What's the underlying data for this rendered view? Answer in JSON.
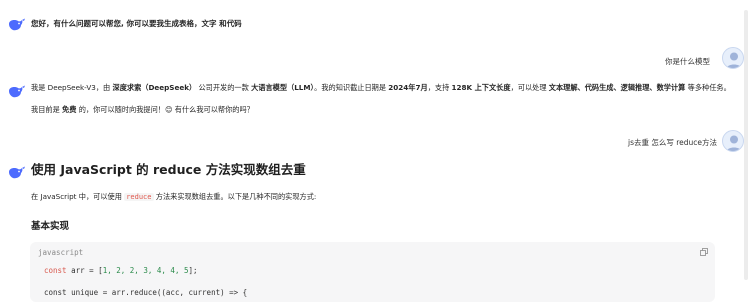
{
  "greeting": {
    "text": "您好，有什么问题可以帮您, 你可以要我生成表格，文字 和代码"
  },
  "messages": {
    "user1": "你是什么模型",
    "bot1": {
      "p1_a": "我是 DeepSeek-V3，由 ",
      "p1_b": "深度求索（DeepSeek）",
      "p1_c": " 公司开发的一款 ",
      "p1_d": "大语言模型（LLM）",
      "p1_e": "。我的知识截止日期是 ",
      "p1_f": "2024年7月",
      "p1_g": "，支持 ",
      "p1_h": "128K 上下文长度",
      "p1_i": "，可以处理 ",
      "p1_j": "文本理解、代码生成、逻辑推理、数学计算",
      "p1_k": " 等多种任务。",
      "p2_a": "我目前是 ",
      "p2_b": "免费",
      "p2_c": " 的，你可以随时向我提问！",
      "p2_emoji": "😊",
      "p2_d": " 有什么我可以帮你的吗？"
    },
    "user2": "js去重 怎么写 reduce方法",
    "bot2": {
      "title": "使用 JavaScript 的 reduce 方法实现数组去重",
      "intro_a": "在 JavaScript 中，可以使用 ",
      "intro_code": "reduce",
      "intro_b": " 方法来实现数组去重。以下是几种不同的实现方式:",
      "section_title": "基本实现",
      "code": {
        "lang": "javascript",
        "line1_kw": "const",
        "line1_rest_a": " arr = [",
        "line1_nums": "1, 2, 2, 3, 4, 4, 5",
        "line1_rest_b": "];",
        "line2": "const unique = arr.reduce((acc, current) => {"
      }
    }
  },
  "colors": {
    "accent": "#4d6bfe",
    "user_bubble_text": "#333333"
  },
  "icons": [
    "deepseek-whale-icon",
    "user-avatar-icon",
    "copy-icon"
  ]
}
